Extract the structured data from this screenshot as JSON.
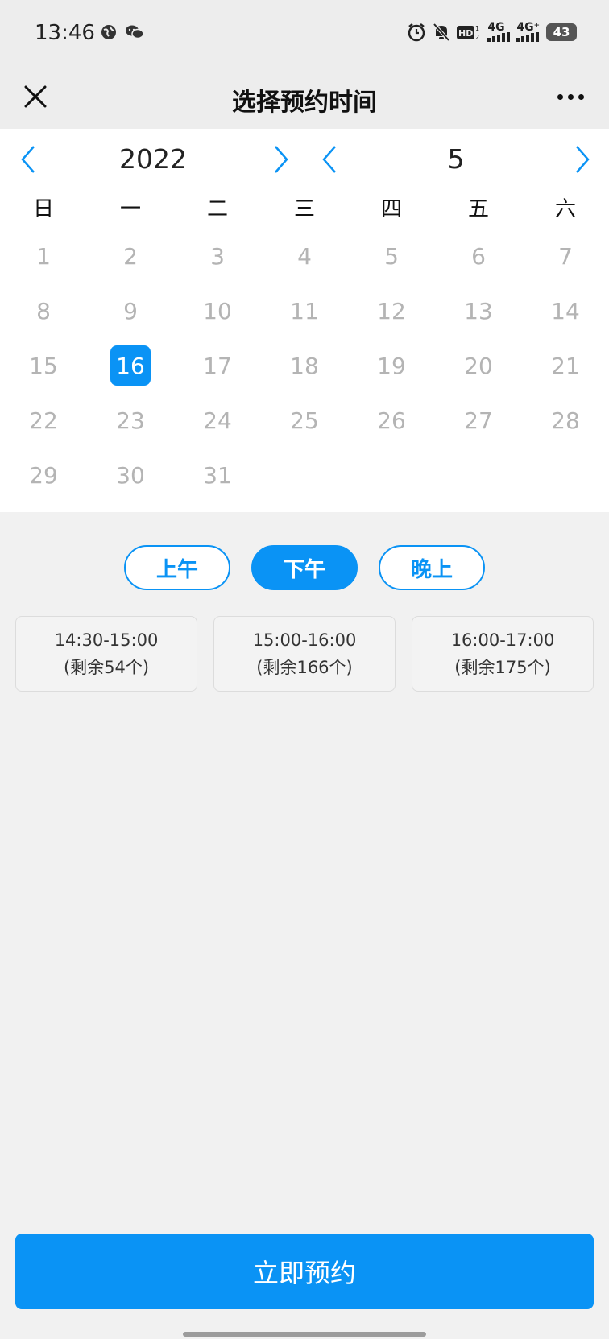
{
  "status_bar": {
    "time": "13:46",
    "network_1": "4G",
    "network_2": "4G⁺",
    "battery": "43"
  },
  "nav": {
    "title": "选择预约时间"
  },
  "calendar": {
    "year": "2022",
    "month": "5",
    "weekdays": [
      "日",
      "一",
      "二",
      "三",
      "四",
      "五",
      "六"
    ],
    "days": [
      "1",
      "2",
      "3",
      "4",
      "5",
      "6",
      "7",
      "8",
      "9",
      "10",
      "11",
      "12",
      "13",
      "14",
      "15",
      "16",
      "17",
      "18",
      "19",
      "20",
      "21",
      "22",
      "23",
      "24",
      "25",
      "26",
      "27",
      "28",
      "29",
      "30",
      "31"
    ],
    "selected_day": "16"
  },
  "periods": [
    {
      "label": "上午",
      "active": false
    },
    {
      "label": "下午",
      "active": true
    },
    {
      "label": "晚上",
      "active": false
    }
  ],
  "slots": [
    {
      "time": "14:30-15:00",
      "remaining": "(剩余54个)"
    },
    {
      "time": "15:00-16:00",
      "remaining": "(剩余166个)"
    },
    {
      "time": "16:00-17:00",
      "remaining": "(剩余175个)"
    }
  ],
  "book_button": "立即预约",
  "colors": {
    "accent": "#0a93f5",
    "disabled_day": "#b4b4b4"
  }
}
